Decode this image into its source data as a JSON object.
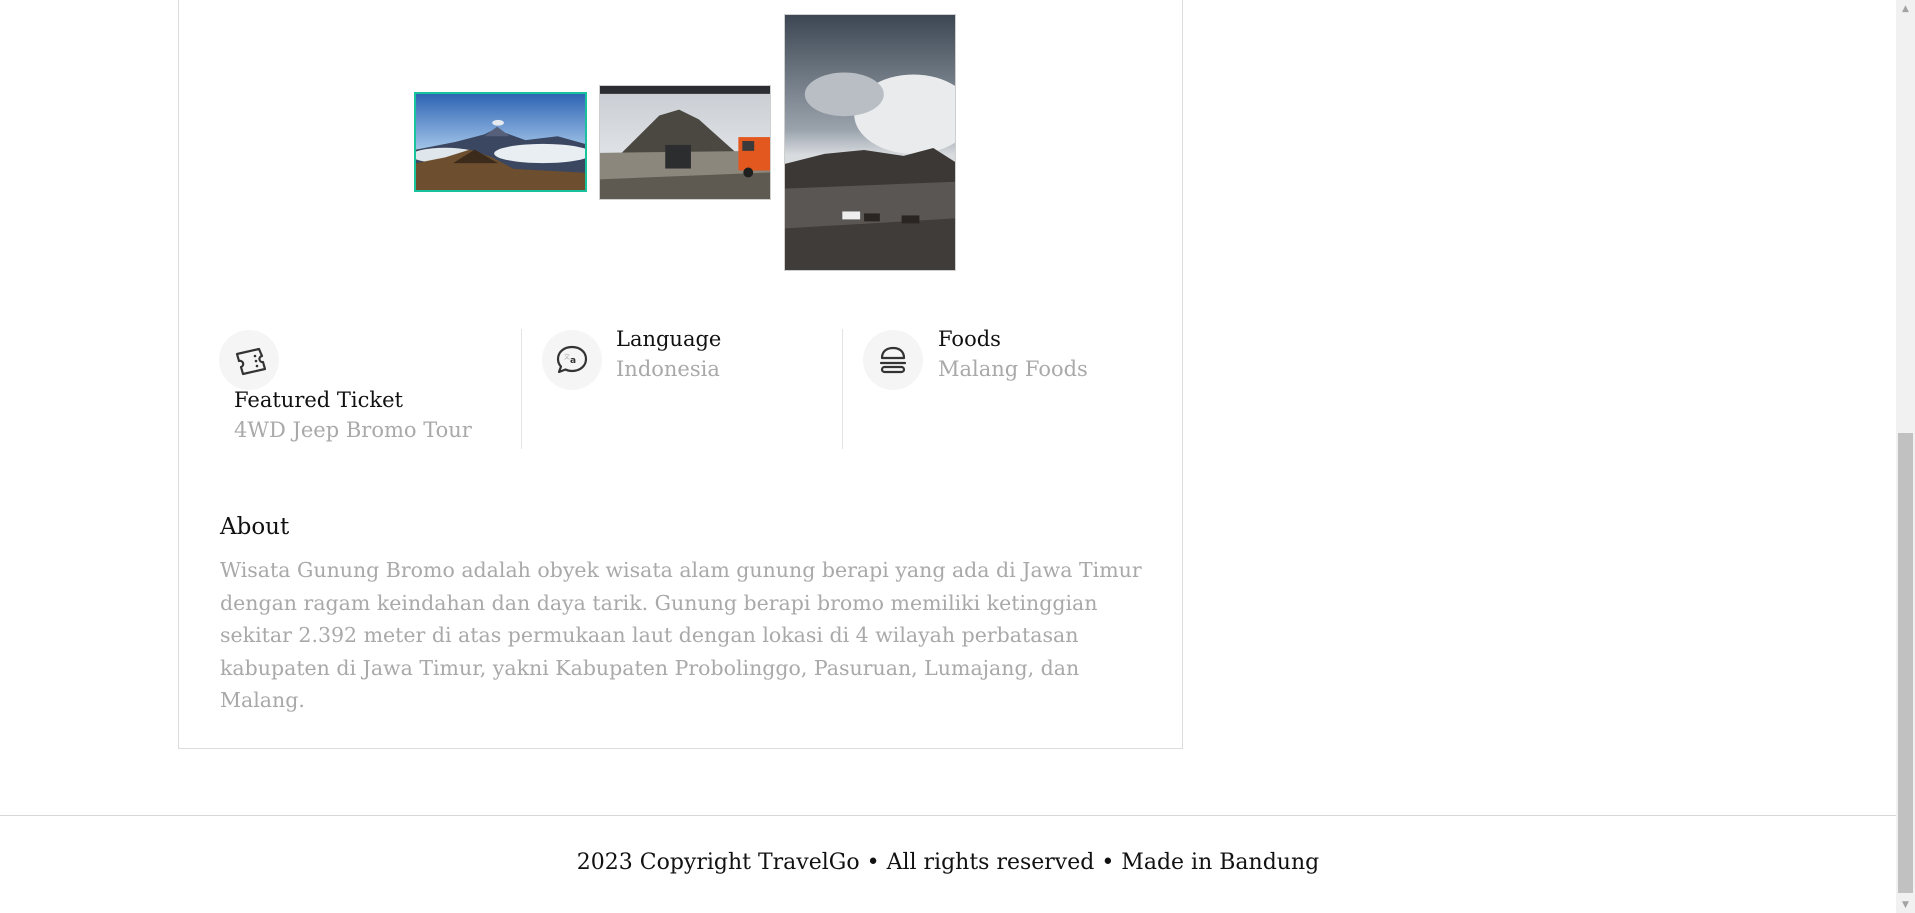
{
  "gallery": {
    "selected_index": 0,
    "accent_color": "#18c29c",
    "images": [
      {
        "alt": "bromo-panorama-image"
      },
      {
        "alt": "jeep-mountain-image"
      },
      {
        "alt": "horse-riders-image"
      }
    ]
  },
  "features": [
    {
      "icon": "ticket-icon",
      "title": "Featured Ticket",
      "value": "4WD Jeep Bromo Tour"
    },
    {
      "icon": "chat-bubble-icon",
      "title": "Language",
      "value": "Indonesia"
    },
    {
      "icon": "burger-icon",
      "title": "Foods",
      "value": "Malang Foods"
    }
  ],
  "about": {
    "title": "About",
    "text": "Wisata Gunung Bromo adalah obyek wisata alam gunung berapi yang ada di Jawa Timur dengan ragam keindahan dan daya tarik. Gunung berapi bromo memiliki ketinggian sekitar 2.392 meter di atas permukaan laut dengan lokasi di 4 wilayah perbatasan kabupaten di Jawa Timur, yakni Kabupaten Probolinggo, Pasuruan, Lumajang, dan Malang."
  },
  "footer": {
    "text": "2023 Copyright TravelGo • All rights reserved • Made in Bandung"
  },
  "colors": {
    "muted_text": "#a9a9a9",
    "border": "#dcdcdc"
  }
}
